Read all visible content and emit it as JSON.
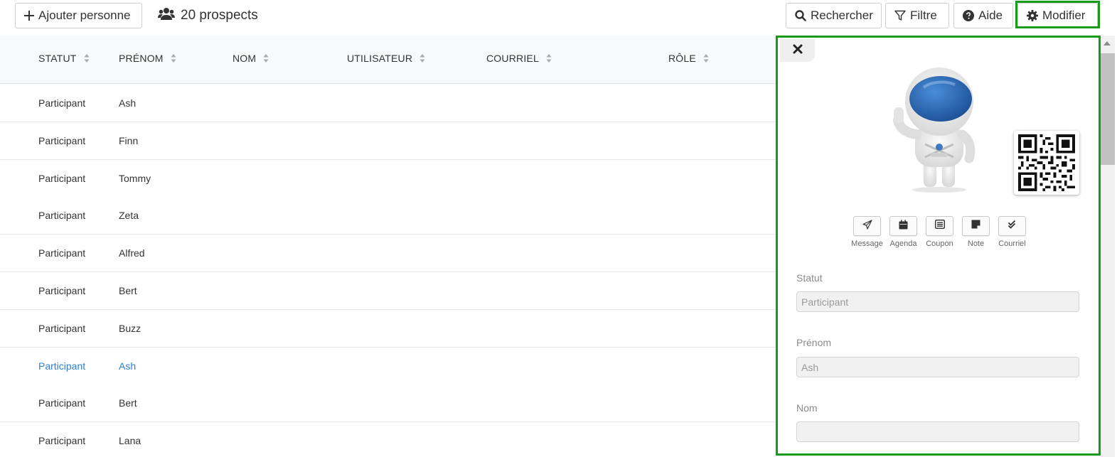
{
  "toolbar": {
    "add_label": "Ajouter personne",
    "prospects_label": "20 prospects",
    "search_label": "Rechercher",
    "filter_label": "Filtre",
    "help_label": "Aide",
    "modify_label": "Modifier"
  },
  "table": {
    "columns": [
      "STATUT",
      "PRÉNOM",
      "NOM",
      "UTILISATEUR",
      "COURRIEL",
      "RÔLE"
    ],
    "rows": [
      {
        "statut": "Participant",
        "prenom": "Ash"
      },
      {
        "statut": "Participant",
        "prenom": "Finn"
      },
      {
        "statut": "Participant",
        "prenom": "Tommy"
      },
      {
        "statut": "Participant",
        "prenom": "Zeta"
      },
      {
        "statut": "Participant",
        "prenom": "Alfred"
      },
      {
        "statut": "Participant",
        "prenom": "Bert"
      },
      {
        "statut": "Participant",
        "prenom": "Buzz"
      },
      {
        "statut": "Participant",
        "prenom": "Ash"
      },
      {
        "statut": "Participant",
        "prenom": "Bert"
      },
      {
        "statut": "Participant",
        "prenom": "Lana"
      }
    ],
    "active_row_index": 7,
    "active_color": "#2f7fd1"
  },
  "panel": {
    "actions": [
      {
        "label": "Message",
        "icon": "paper-plane-icon"
      },
      {
        "label": "Agenda",
        "icon": "calendar-icon"
      },
      {
        "label": "Coupon",
        "icon": "coupon-icon"
      },
      {
        "label": "Note",
        "icon": "note-icon"
      },
      {
        "label": "Courriel",
        "icon": "double-check-icon"
      }
    ],
    "fields": {
      "statut_label": "Statut",
      "statut_value": "Participant",
      "prenom_label": "Prénom",
      "prenom_value": "Ash",
      "nom_label": "Nom",
      "nom_value": ""
    }
  },
  "colors": {
    "highlight": "#1a9a1a",
    "header_bg": "#f8f9fa"
  }
}
